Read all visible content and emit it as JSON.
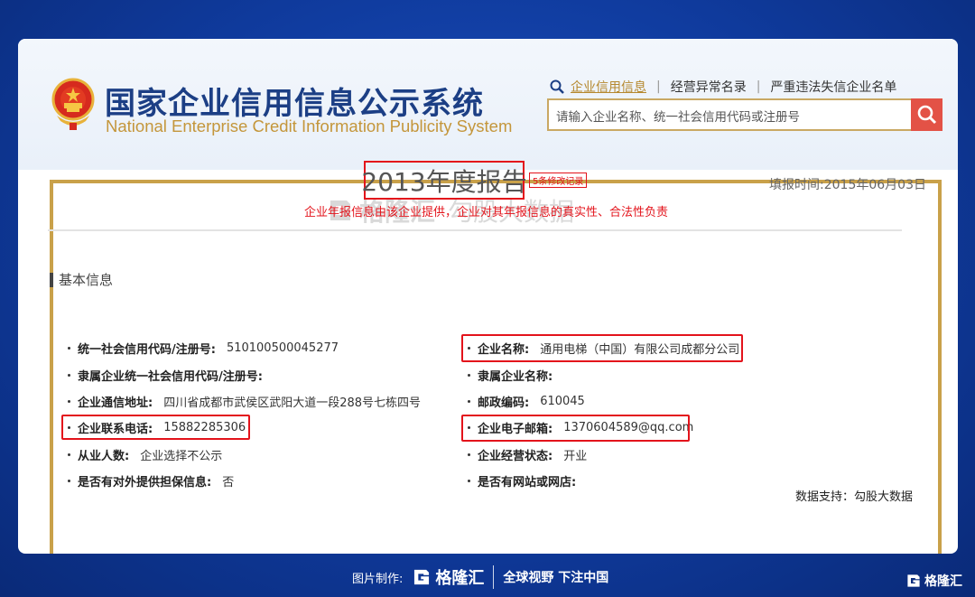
{
  "site": {
    "title_cn": "国家企业信用信息公示系统",
    "title_en": "National Enterprise Credit Information Publicity System"
  },
  "topnav": {
    "items": [
      "企业信用信息",
      "经营异常名录",
      "严重违法失信企业名单"
    ],
    "separator": "|"
  },
  "search": {
    "placeholder": "请输入企业名称、统一社会信用代码或注册号"
  },
  "report": {
    "title": "2013年度报告",
    "modify_badge": "5条修改记录",
    "fill_date": "填报时间:2015年06月03日",
    "disclaimer": "企业年报信息由该企业提供，企业对其年报信息的真实性、合法性负责"
  },
  "watermark": {
    "brand": "格隆汇",
    "subtitle": "勾股大数据",
    "url": "www.gelonghui.com"
  },
  "basic_info": {
    "section_title": "基本信息",
    "left": [
      {
        "label": "统一社会信用代码/注册号:",
        "value": "510100500045277"
      },
      {
        "label": "隶属企业统一社会信用代码/注册号:",
        "value": ""
      },
      {
        "label": "企业通信地址:",
        "value": "四川省成都市武侯区武阳大道一段288号七栋四号"
      },
      {
        "label": "企业联系电话:",
        "value": "15882285306"
      },
      {
        "label": "从业人数:",
        "value": "企业选择不公示"
      },
      {
        "label": "是否有对外提供担保信息:",
        "value": "否"
      }
    ],
    "right": [
      {
        "label": "企业名称:",
        "value": "通用电梯（中国）有限公司成都分公司"
      },
      {
        "label": "隶属企业名称:",
        "value": ""
      },
      {
        "label": "邮政编码:",
        "value": "610045"
      },
      {
        "label": "企业电子邮箱:",
        "value": "1370604589@qq.com"
      },
      {
        "label": "企业经营状态:",
        "value": "开业"
      },
      {
        "label": "是否有网站或网店:",
        "value": ""
      }
    ]
  },
  "data_support": "数据支持：勾股大数据",
  "footer": {
    "credit": "图片制作:",
    "brand": "格隆汇",
    "brand_url": "www.gelonghui.com",
    "slogan": "全球视野 下注中国"
  },
  "colors": {
    "highlight_red": "#e3131b",
    "brand_navy": "#1c3f85",
    "gold": "#c9a14a",
    "background_blue": "#1a4fc0",
    "search_button": "#e35246"
  },
  "icons": {
    "emblem": "national-emblem-icon",
    "search": "magnifier-icon",
    "brand_logo": "gelonghui-g-logo-icon"
  }
}
